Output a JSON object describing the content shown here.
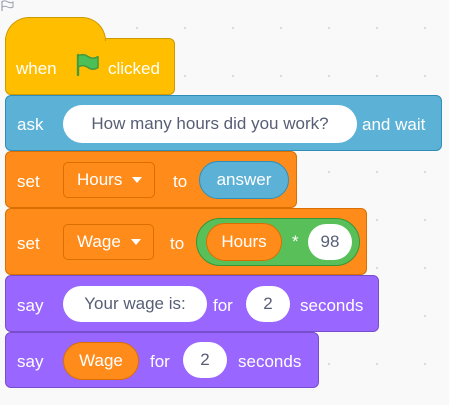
{
  "script": {
    "hat": {
      "label_when": "when",
      "label_clicked": "clicked",
      "icon": "green-flag-icon"
    },
    "ask": {
      "label": "ask",
      "question": "How many hours did you work?",
      "label_wait": "and wait"
    },
    "set1": {
      "label": "set",
      "variable": "Hours",
      "label_to": "to",
      "value_reporter": "answer"
    },
    "set2": {
      "label": "set",
      "variable": "Wage",
      "label_to": "to",
      "operator": {
        "left": "Hours",
        "symbol": "*",
        "right": "98"
      }
    },
    "say1": {
      "label": "say",
      "message": "Your wage is:",
      "label_for": "for",
      "seconds": "2",
      "label_seconds": "seconds"
    },
    "say2": {
      "label": "say",
      "message_reporter": "Wage",
      "label_for": "for",
      "seconds": "2",
      "label_seconds": "seconds"
    }
  },
  "colors": {
    "events": "#ffbf00",
    "sensing": "#5cb1d6",
    "variables": "#ff8c1a",
    "operators": "#59c059",
    "looks": "#9966ff",
    "flag": "#4cbf56"
  }
}
